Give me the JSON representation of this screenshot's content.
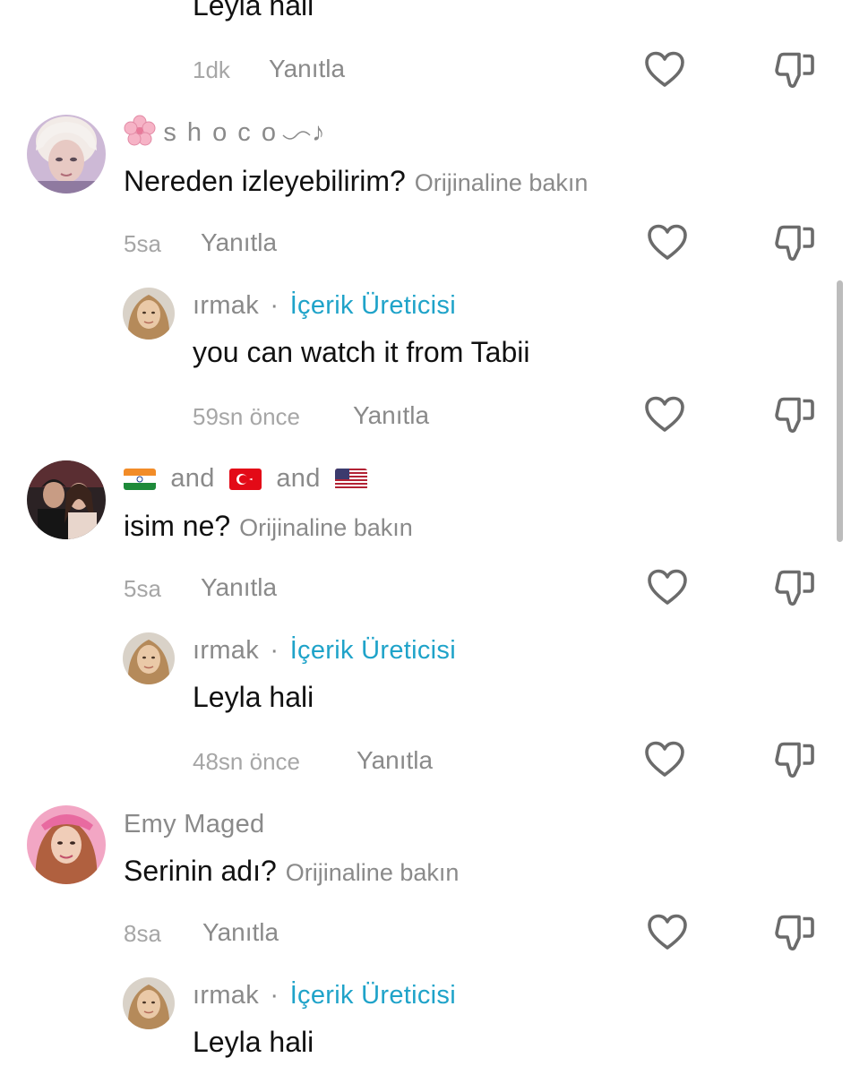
{
  "comments": [
    {
      "id": "c0",
      "text": "Leyla hali",
      "time": "1dk",
      "reply": "Yanıtla"
    },
    {
      "id": "c1",
      "username": "s h o c o",
      "username_suffix": "♪",
      "text": "Nereden izleyebilirim?",
      "see_original": "Orijinaline bakın",
      "time": "5sa",
      "reply": "Yanıtla",
      "replies": [
        {
          "username": "ırmak",
          "separator": "·",
          "badge": "İçerik Üreticisi",
          "text": "you can watch it from Tabii",
          "time": "59sn önce",
          "reply": "Yanıtla"
        }
      ]
    },
    {
      "id": "c2",
      "username_parts": [
        "and",
        "and"
      ],
      "flags": [
        "india-flag",
        "turkey-flag",
        "usa-flag"
      ],
      "text": "isim ne?",
      "see_original": "Orijinaline bakın",
      "time": "5sa",
      "reply": "Yanıtla",
      "replies": [
        {
          "username": "ırmak",
          "separator": "·",
          "badge": "İçerik Üreticisi",
          "text": "Leyla hali",
          "time": "48sn önce",
          "reply": "Yanıtla"
        }
      ]
    },
    {
      "id": "c3",
      "username": "Emy Maged",
      "text": "Serinin adı?",
      "see_original": "Orijinaline bakın",
      "time": "8sa",
      "reply": "Yanıtla",
      "replies": [
        {
          "username": "ırmak",
          "separator": "·",
          "badge": "İçerik Üreticisi",
          "text": "Leyla hali"
        }
      ]
    }
  ],
  "icons": [
    "heart-icon",
    "dislike-icon",
    "cherry-blossom-icon"
  ],
  "colors": {
    "creator_badge": "#1fa3c9",
    "secondary_text": "#8a8a8a",
    "primary_text": "#111111"
  }
}
